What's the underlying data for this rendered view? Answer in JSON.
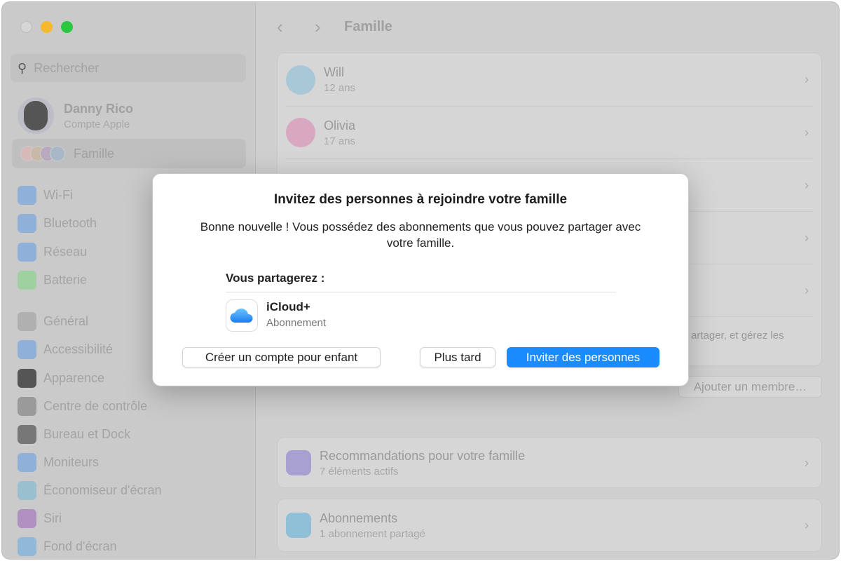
{
  "window": {
    "controls": [
      "close",
      "minimize",
      "zoom"
    ]
  },
  "sidebar": {
    "search_placeholder": "Rechercher",
    "account": {
      "name": "Danny Rico",
      "subtitle": "Compte Apple"
    },
    "family": "Famille",
    "items": [
      {
        "label": "Wi-Fi",
        "icon": "wifi-icon",
        "color": "#8fb0d8"
      },
      {
        "label": "Bluetooth",
        "icon": "bluetooth-icon",
        "color": "#8fb0d8"
      },
      {
        "label": "Réseau",
        "icon": "globe-icon",
        "color": "#8fb0d8"
      },
      {
        "label": "Batterie",
        "icon": "battery-icon",
        "color": "#9fd09f"
      },
      {
        "label": "Général",
        "icon": "gear-icon",
        "color": "#b0b0b0"
      },
      {
        "label": "Accessibilité",
        "icon": "accessibility-icon",
        "color": "#8fb0d8"
      },
      {
        "label": "Apparence",
        "icon": "appearance-icon",
        "color": "#555555"
      },
      {
        "label": "Centre de contrôle",
        "icon": "control-center-icon",
        "color": "#9a9a9a"
      },
      {
        "label": "Bureau et Dock",
        "icon": "dock-icon",
        "color": "#777777"
      },
      {
        "label": "Moniteurs",
        "icon": "sun-icon",
        "color": "#8fb0d8"
      },
      {
        "label": "Économiseur d'écran",
        "icon": "screensaver-icon",
        "color": "#9ac0d0"
      },
      {
        "label": "Siri",
        "icon": "siri-icon",
        "color": "#b090c0"
      },
      {
        "label": "Fond d'écran",
        "icon": "wallpaper-icon",
        "color": "#90b8d8"
      }
    ]
  },
  "main": {
    "title": "Famille",
    "members": [
      {
        "name": "Will",
        "age": "12 ans",
        "color": "#a8c8d8"
      },
      {
        "name": "Olivia",
        "age": "17 ans",
        "color": "#d8a8c0"
      }
    ],
    "partial_text": "artager, et gérez les",
    "add_member": "Ajouter un membre…",
    "recommendations": {
      "title": "Recommandations pour votre famille",
      "subtitle": "7 éléments actifs"
    },
    "subscriptions": {
      "title": "Abonnements",
      "subtitle": "1 abonnement partagé"
    }
  },
  "dialog": {
    "title": "Invitez des personnes à rejoindre votre famille",
    "description": "Bonne nouvelle ! Vous possédez des abonnements que vous pouvez partager avec votre famille.",
    "share_heading": "Vous partagerez :",
    "item": {
      "name": "iCloud+",
      "type": "Abonnement"
    },
    "buttons": {
      "child": "Créer un compte pour enfant",
      "later": "Plus tard",
      "invite": "Inviter des personnes"
    },
    "accent": "#1a8cff"
  }
}
